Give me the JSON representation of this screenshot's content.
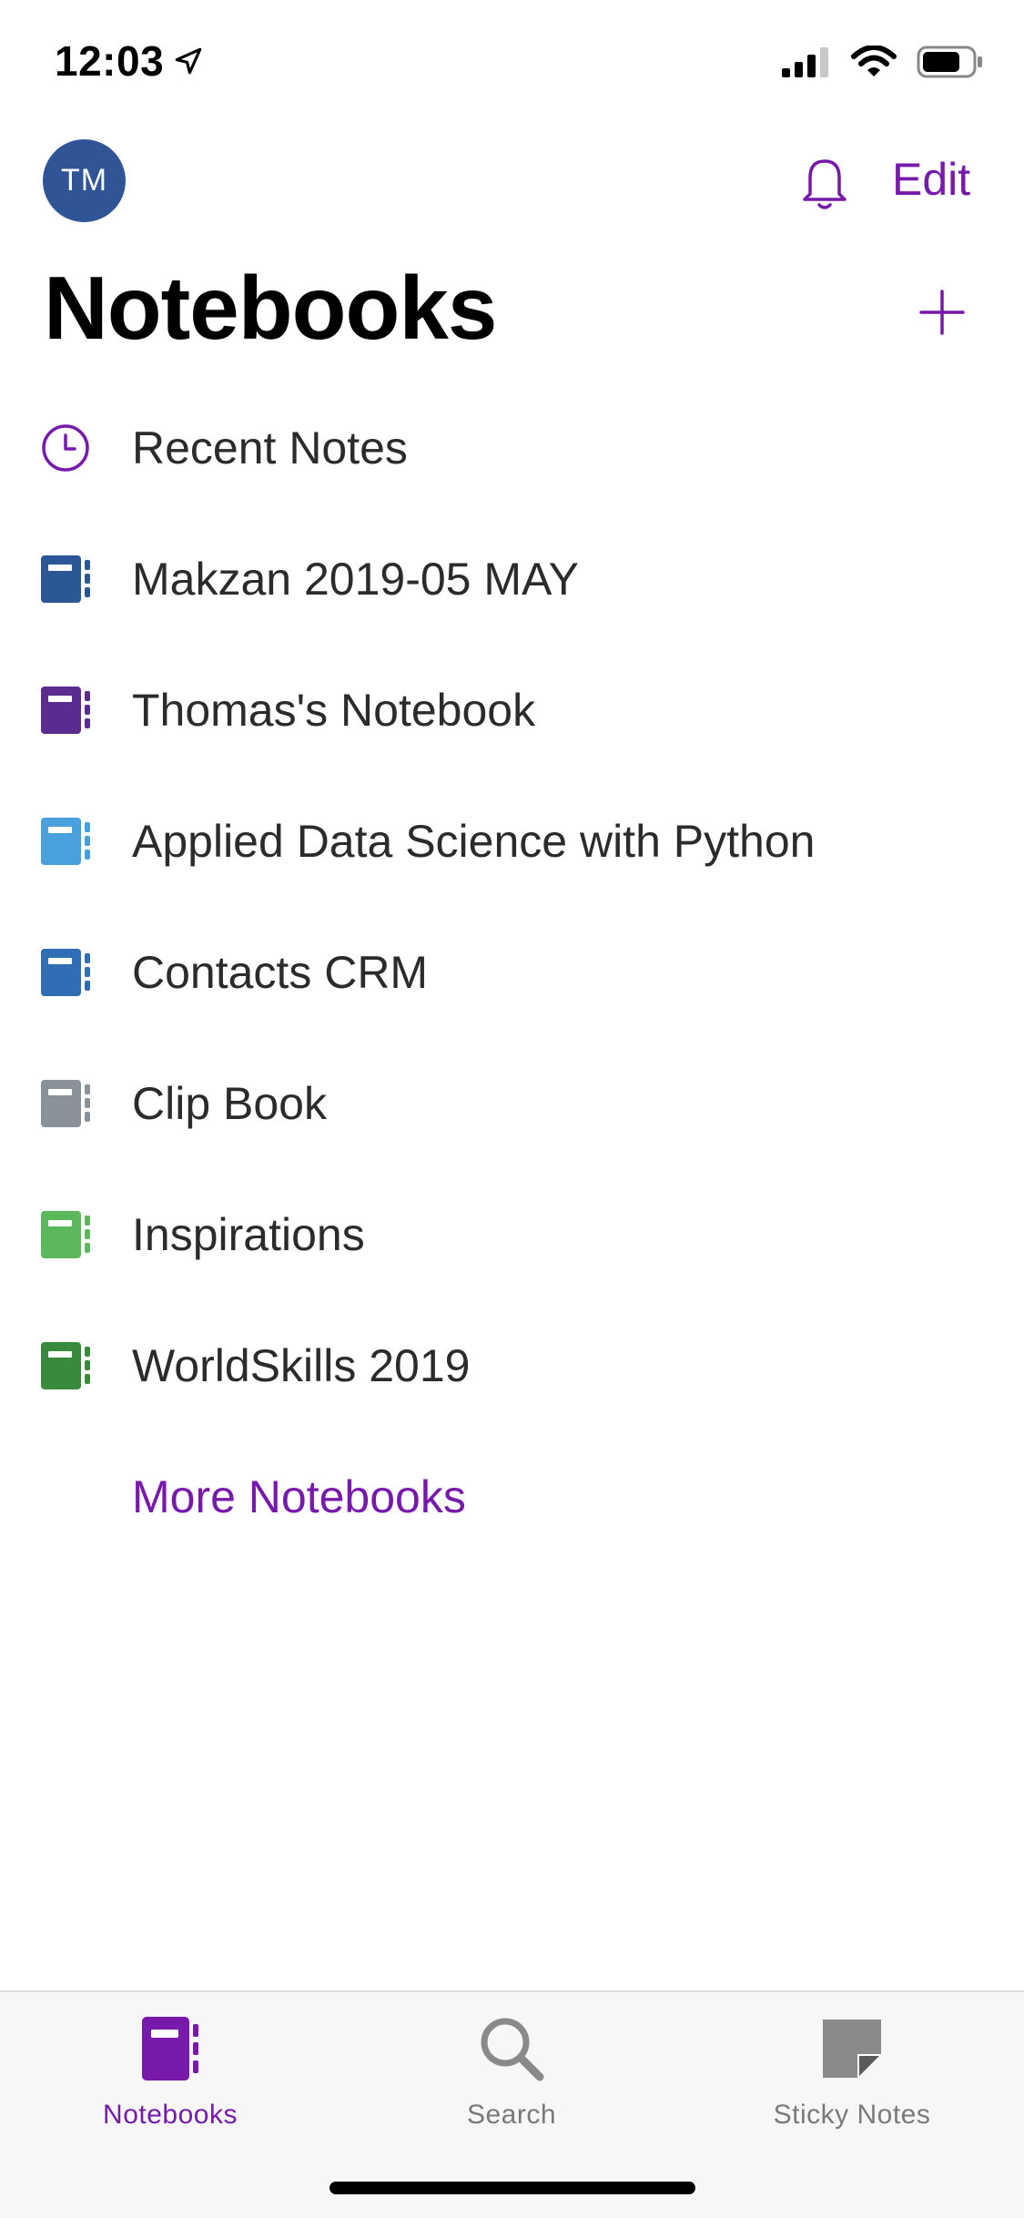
{
  "status_bar": {
    "time": "12:03",
    "icons": [
      "location-arrow-icon",
      "cellular-signal-icon",
      "wifi-icon",
      "battery-icon"
    ]
  },
  "header": {
    "avatar_initials": "TM",
    "avatar_color": "#2f5597",
    "edit_label": "Edit",
    "title": "Notebooks",
    "accent_color": "#7719aa"
  },
  "list": {
    "recent": {
      "label": "Recent Notes",
      "icon": "clock-icon"
    },
    "notebooks": [
      {
        "label": "Makzan 2019-05 MAY",
        "color": "#2b5797",
        "icon": "notebook-icon"
      },
      {
        "label": "Thomas's Notebook",
        "color": "#5b2c8f",
        "icon": "notebook-icon"
      },
      {
        "label": "Applied Data Science with Python",
        "color": "#4aa0dc",
        "icon": "notebook-icon"
      },
      {
        "label": "Contacts CRM",
        "color": "#2f6db5",
        "icon": "notebook-icon"
      },
      {
        "label": "Clip Book",
        "color": "#8a9299",
        "icon": "notebook-icon"
      },
      {
        "label": "Inspirations",
        "color": "#5cb85c",
        "icon": "notebook-icon"
      },
      {
        "label": "WorldSkills 2019",
        "color": "#3a8a3e",
        "icon": "notebook-icon"
      }
    ],
    "more_label": "More Notebooks"
  },
  "tab_bar": {
    "tabs": [
      {
        "label": "Notebooks",
        "icon": "notebook-icon",
        "active": true
      },
      {
        "label": "Search",
        "icon": "search-icon",
        "active": false
      },
      {
        "label": "Sticky Notes",
        "icon": "sticky-note-icon",
        "active": false
      }
    ]
  }
}
